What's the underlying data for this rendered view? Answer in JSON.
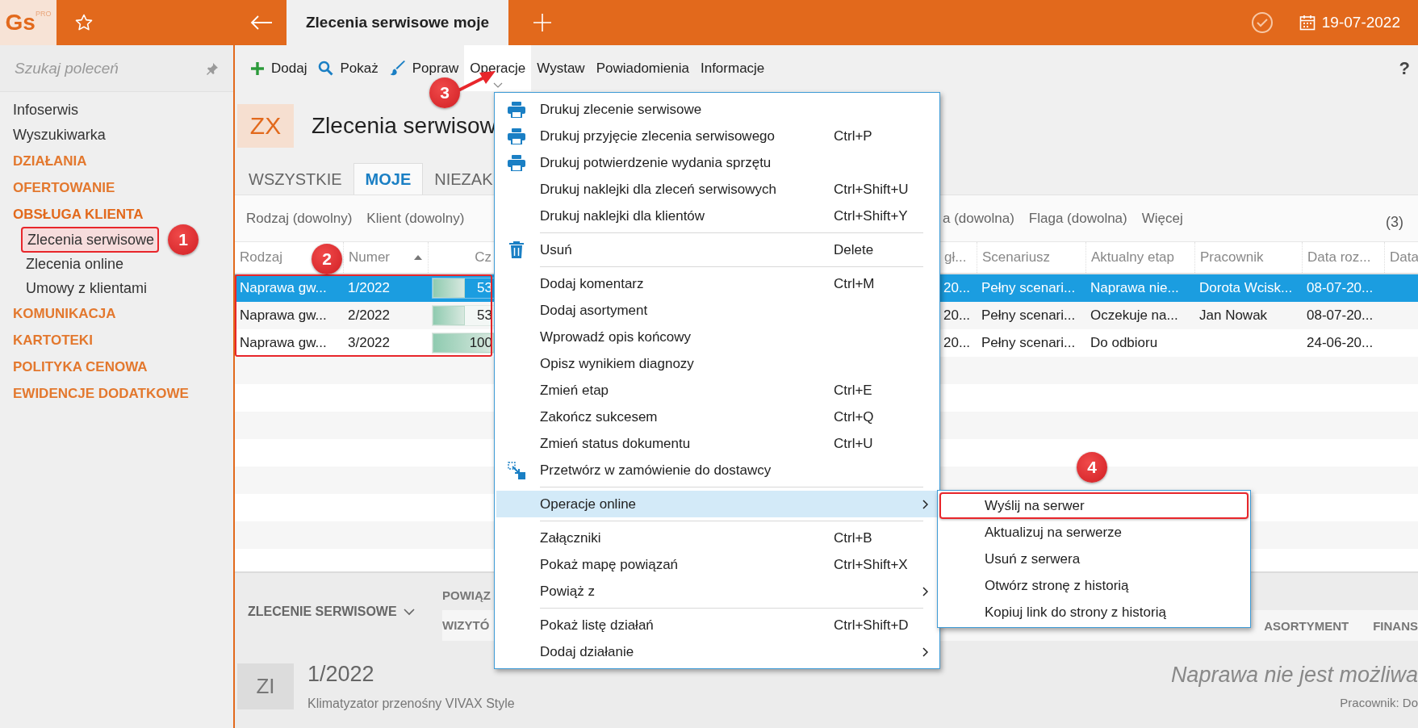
{
  "app": {
    "logo": "Gs",
    "logo_badge": "PRO",
    "tab_title": "Zlecenia serwisowe moje",
    "date": "19-07-2022"
  },
  "sidebar": {
    "search_placeholder": "Szukaj poleceń",
    "items": [
      {
        "kind": "link",
        "label": "Infoserwis"
      },
      {
        "kind": "link",
        "label": "Wyszukiwarka"
      },
      {
        "kind": "group",
        "label": "DZIAŁANIA",
        "expanded": false
      },
      {
        "kind": "group",
        "label": "OFERTOWANIE",
        "expanded": false
      },
      {
        "kind": "group",
        "label": "OBSŁUGA KLIENTA",
        "expanded": true,
        "children": [
          {
            "label": "Zlecenia serwisowe",
            "marker": "1"
          },
          {
            "label": "Zlecenia online"
          },
          {
            "label": "Umowy z klientami"
          }
        ]
      },
      {
        "kind": "group",
        "label": "KOMUNIKACJA",
        "expanded": false
      },
      {
        "kind": "group",
        "label": "KARTOTEKI",
        "expanded": false
      },
      {
        "kind": "group",
        "label": "POLITYKA CENOWA",
        "expanded": false
      },
      {
        "kind": "group",
        "label": "EWIDENCJE DODATKOWE",
        "expanded": false
      }
    ]
  },
  "toolbar": {
    "items": [
      {
        "label": "Dodaj",
        "selected": false
      },
      {
        "label": "Pokaż",
        "selected": false
      },
      {
        "label": "Popraw",
        "selected": false
      },
      {
        "label": "Operacje",
        "selected": true,
        "marker": "3"
      },
      {
        "label": "Wystaw",
        "selected": false
      },
      {
        "label": "Powiadomienia",
        "selected": false
      },
      {
        "label": "Informacje",
        "selected": false
      }
    ],
    "help": "?"
  },
  "view": {
    "badge": "ZX",
    "title": "Zlecenia serwisow",
    "tabs": [
      {
        "label": "WSZYSTKIE",
        "selected": false
      },
      {
        "label": "MOJE",
        "selected": true
      },
      {
        "label": "NIEZAK",
        "selected": false
      }
    ],
    "filters_left": [
      "Rodzaj (dowolny)",
      "Klient (dowolny)"
    ],
    "filters_right": [
      "a (dowolna)",
      "Flaga (dowolna)",
      "Więcej"
    ],
    "count": "(3)"
  },
  "table": {
    "marker": "2",
    "columns": [
      {
        "kind": "text",
        "label": "Rodzaj",
        "sorted": false
      },
      {
        "kind": "text",
        "label": "Numer",
        "sorted": true
      },
      {
        "kind": "progress",
        "label": "Cz",
        "sorted": false
      },
      {
        "kind": "text",
        "label": "gł...",
        "sorted": false
      },
      {
        "kind": "text",
        "label": "Scenariusz",
        "sorted": false
      },
      {
        "kind": "text",
        "label": "Aktualny etap",
        "sorted": false
      },
      {
        "kind": "text",
        "label": "Pracownik",
        "sorted": false
      },
      {
        "kind": "text",
        "label": "Data roz...",
        "sorted": false
      },
      {
        "kind": "text",
        "label": "Data",
        "sorted": false
      }
    ],
    "rows": [
      {
        "selected": true,
        "level": 0.53,
        "cells": [
          "Naprawa gw...",
          "1/2022",
          "53",
          "20...",
          "Pełny scenari...",
          "Naprawa nie...",
          "Dorota Wcisk...",
          "08-07-20..."
        ]
      },
      {
        "selected": false,
        "level": 0.53,
        "cells": [
          "Naprawa gw...",
          "2/2022",
          "53",
          "20...",
          "Pełny scenari...",
          "Oczekuje na...",
          "Jan Nowak",
          "08-07-20..."
        ]
      },
      {
        "selected": false,
        "level": 1.0,
        "cells": [
          "Naprawa gw...",
          "3/2022",
          "100",
          "20...",
          "Pełny scenari...",
          "Do odbioru",
          null,
          "24-06-20..."
        ]
      }
    ]
  },
  "context_menu": {
    "groups": [
      [
        {
          "label": "Drukuj zlecenie serwisowe",
          "highlighted": false
        },
        {
          "label": "Drukuj przyjęcie zlecenia serwisowego",
          "shortcut": "Ctrl+P",
          "highlighted": false
        },
        {
          "label": "Drukuj potwierdzenie wydania sprzętu",
          "highlighted": false
        },
        {
          "label": "Drukuj naklejki dla zleceń serwisowych",
          "shortcut": "Ctrl+Shift+U",
          "highlighted": false
        },
        {
          "label": "Drukuj naklejki dla klientów",
          "shortcut": "Ctrl+Shift+Y",
          "highlighted": false
        }
      ],
      [
        {
          "label": "Usuń",
          "shortcut": "Delete",
          "highlighted": false
        }
      ],
      [
        {
          "label": "Dodaj komentarz",
          "shortcut": "Ctrl+M",
          "highlighted": false
        },
        {
          "label": "Dodaj asortyment",
          "highlighted": false
        },
        {
          "label": "Wprowadź opis końcowy",
          "highlighted": false
        },
        {
          "label": "Opisz wynikiem diagnozy",
          "highlighted": false
        },
        {
          "label": "Zmień etap",
          "shortcut": "Ctrl+E",
          "highlighted": false
        },
        {
          "label": "Zakończ sukcesem",
          "shortcut": "Ctrl+Q",
          "highlighted": false
        },
        {
          "label": "Zmień status dokumentu",
          "shortcut": "Ctrl+U",
          "highlighted": false
        },
        {
          "label": "Przetwórz w zamówienie do dostawcy",
          "highlighted": false
        }
      ],
      [
        {
          "label": "Operacje online",
          "submenu": true,
          "highlighted": true
        }
      ],
      [
        {
          "label": "Załączniki",
          "shortcut": "Ctrl+B",
          "highlighted": false
        },
        {
          "label": "Pokaż mapę powiązań",
          "shortcut": "Ctrl+Shift+X",
          "highlighted": false
        },
        {
          "label": "Powiąż z",
          "submenu": true,
          "highlighted": false
        }
      ],
      [
        {
          "label": "Pokaż listę działań",
          "shortcut": "Ctrl+Shift+D",
          "highlighted": false
        },
        {
          "label": "Dodaj działanie",
          "submenu": true,
          "highlighted": false
        }
      ]
    ]
  },
  "submenu": {
    "items": [
      {
        "label": "Wyślij na serwer",
        "marker": "4"
      },
      {
        "label": "Aktualizuj na serwerze"
      },
      {
        "label": "Usuń z serwera"
      },
      {
        "label": "Otwórz stronę z historią"
      },
      {
        "label": "Kopiuj link do strony z historią"
      }
    ]
  },
  "bottom_panel": {
    "section": "ZLECENIE SERWISOWE",
    "tabs_top": [
      "POWIĄZ"
    ],
    "tabs_left": [
      "WIZYTÓ"
    ],
    "tabs_right": [
      "ASORTYMENT",
      "FINANS"
    ],
    "badge": "ZI",
    "number": "1/2022",
    "description": "Klimatyzator przenośny VIVAX Style",
    "status": "Naprawa nie jest możliwa",
    "employee": "Pracownik: Do"
  }
}
